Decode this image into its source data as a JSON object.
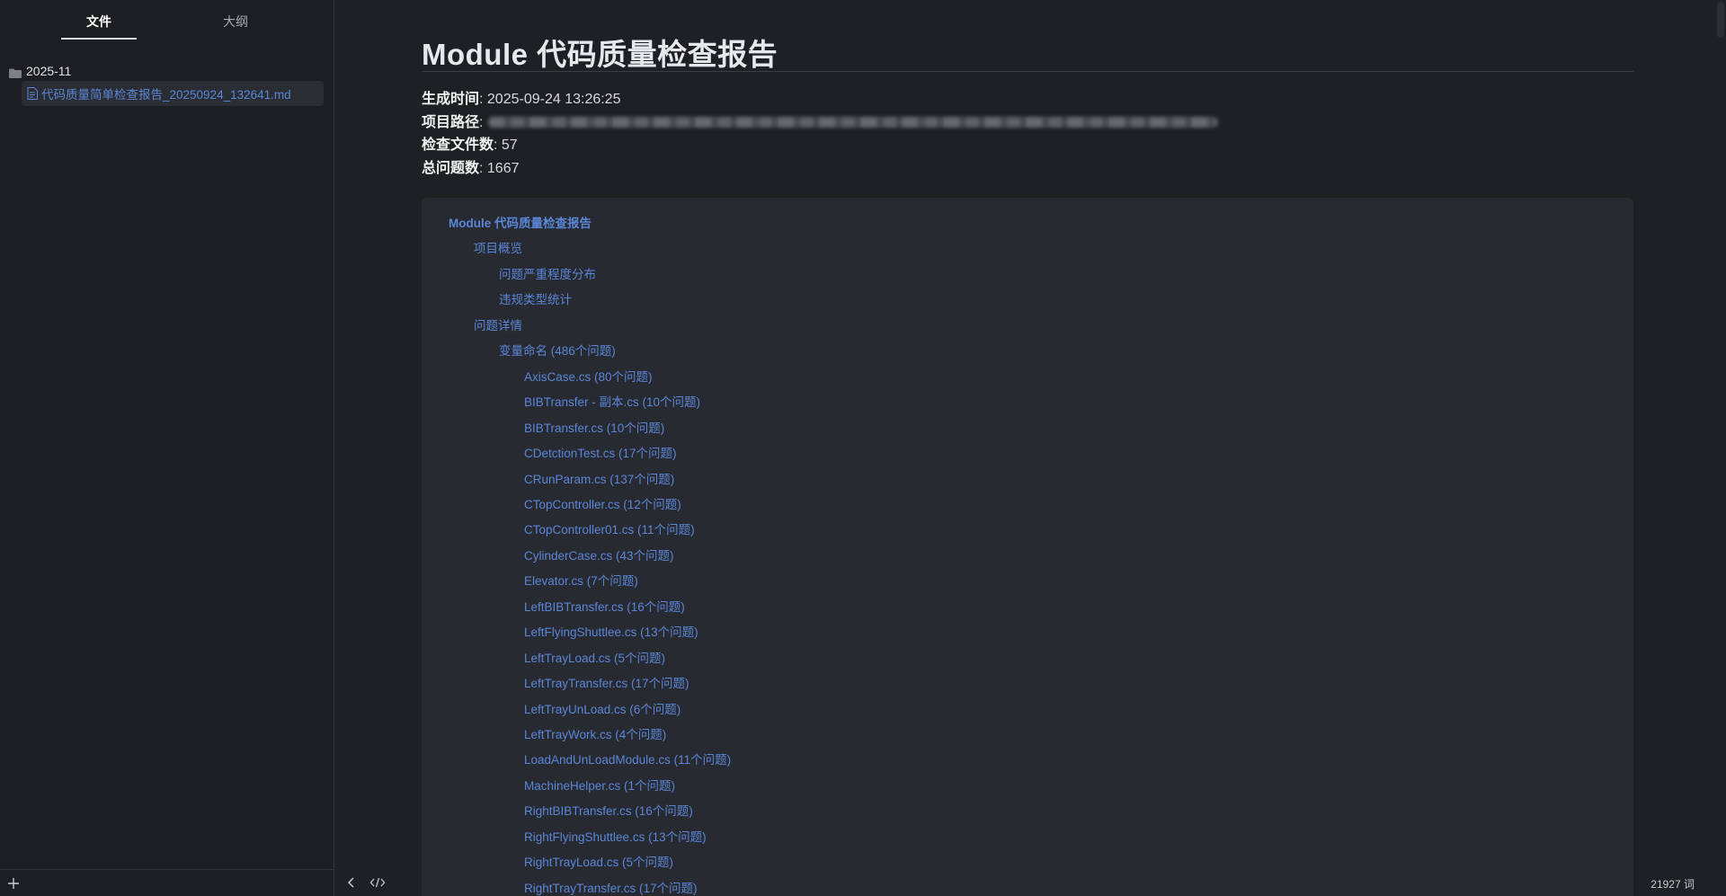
{
  "sidebar": {
    "tabs": [
      {
        "label": "文件",
        "active": true
      },
      {
        "label": "大纲",
        "active": false
      }
    ],
    "folder": {
      "name": "2025-11",
      "icon": "folder-icon"
    },
    "file": {
      "name": "代码质量简单检查报告_20250924_132641.md",
      "icon": "file-icon",
      "selected": true
    },
    "footer": {
      "add_icon": "plus-icon"
    }
  },
  "document": {
    "title": "Module 代码质量检查报告",
    "meta": [
      {
        "label": "生成时间",
        "value": "2025-09-24 13:26:25"
      },
      {
        "label": "项目路径",
        "value": ""
      },
      {
        "label": "检查文件数",
        "value": "57"
      },
      {
        "label": "总问题数",
        "value": "1667"
      }
    ],
    "toc": [
      {
        "level": 1,
        "text": "Module 代码质量检查报告"
      },
      {
        "level": 2,
        "text": "项目概览"
      },
      {
        "level": 3,
        "text": "问题严重程度分布"
      },
      {
        "level": 3,
        "text": "违规类型统计"
      },
      {
        "level": 2,
        "text": "问题详情"
      },
      {
        "level": 3,
        "text": "变量命名 (486个问题)"
      },
      {
        "level": 4,
        "text": "AxisCase.cs (80个问题)"
      },
      {
        "level": 4,
        "text": "BIBTransfer - 副本.cs (10个问题)"
      },
      {
        "level": 4,
        "text": "BIBTransfer.cs (10个问题)"
      },
      {
        "level": 4,
        "text": "CDetctionTest.cs (17个问题)"
      },
      {
        "level": 4,
        "text": "CRunParam.cs (137个问题)"
      },
      {
        "level": 4,
        "text": "CTopController.cs (12个问题)"
      },
      {
        "level": 4,
        "text": "CTopController01.cs (11个问题)"
      },
      {
        "level": 4,
        "text": "CylinderCase.cs (43个问题)"
      },
      {
        "level": 4,
        "text": "Elevator.cs (7个问题)"
      },
      {
        "level": 4,
        "text": "LeftBIBTransfer.cs (16个问题)"
      },
      {
        "level": 4,
        "text": "LeftFlyingShuttlee.cs (13个问题)"
      },
      {
        "level": 4,
        "text": "LeftTrayLoad.cs (5个问题)"
      },
      {
        "level": 4,
        "text": "LeftTrayTransfer.cs (17个问题)"
      },
      {
        "level": 4,
        "text": "LeftTrayUnLoad.cs (6个问题)"
      },
      {
        "level": 4,
        "text": "LeftTrayWork.cs (4个问题)"
      },
      {
        "level": 4,
        "text": "LoadAndUnLoadModule.cs (11个问题)"
      },
      {
        "level": 4,
        "text": "MachineHelper.cs (1个问题)"
      },
      {
        "level": 4,
        "text": "RightBIBTransfer.cs (16个问题)"
      },
      {
        "level": 4,
        "text": "RightFlyingShuttlee.cs (13个问题)"
      },
      {
        "level": 4,
        "text": "RightTrayLoad.cs (5个问题)"
      },
      {
        "level": 4,
        "text": "RightTrayTransfer.cs (17个问题)"
      }
    ]
  },
  "statusbar": {
    "word_count": "21927 词",
    "nav_icon": "chevron-left-icon",
    "source_icon": "code-icon"
  },
  "colors": {
    "background": "#1f2024",
    "link": "#5b86d6",
    "toc_background": "#272a31"
  }
}
